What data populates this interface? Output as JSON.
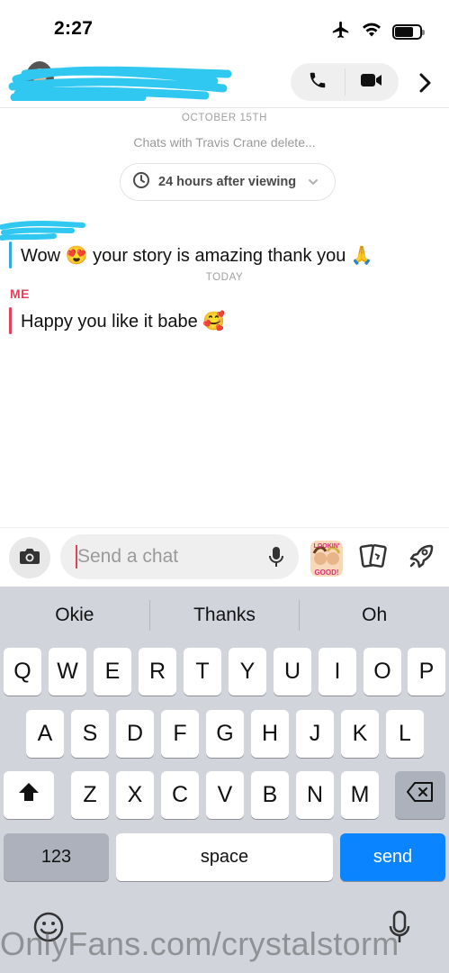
{
  "status_bar": {
    "time": "2:27"
  },
  "header": {
    "call_icon": "phone-icon",
    "video_icon": "video-camera-icon",
    "more_icon": "chevron-right-icon"
  },
  "conversation": {
    "date_label": "OCTOBER 15TH",
    "deleted_notice": "Chats with Travis Crane delete...",
    "timer_label": "24 hours after viewing",
    "messages": [
      {
        "sender": "friend",
        "text": "Wow 😍 your story is amazing thank you 🙏"
      },
      {
        "sender": "me",
        "label": "ME",
        "text": "Happy you like it babe 🥰"
      }
    ],
    "today_label": "TODAY"
  },
  "input": {
    "placeholder": "Send a chat",
    "sticker_text": "LOOKIN' GOOD!"
  },
  "keyboard": {
    "suggestions": [
      "Okie",
      "Thanks",
      "Oh"
    ],
    "row1": [
      "Q",
      "W",
      "E",
      "R",
      "T",
      "Y",
      "U",
      "I",
      "O",
      "P"
    ],
    "row2": [
      "A",
      "S",
      "D",
      "F",
      "G",
      "H",
      "J",
      "K",
      "L"
    ],
    "row3": [
      "Z",
      "X",
      "C",
      "V",
      "B",
      "N",
      "M"
    ],
    "numbers_label": "123",
    "space_label": "space",
    "send_label": "send"
  },
  "watermark": "OnlyFans.com/crystalstorm",
  "colors": {
    "me_accent": "#e0425a",
    "friend_accent": "#33a9e6",
    "send_key": "#0a84ff",
    "scribble": "#30c8f0"
  }
}
